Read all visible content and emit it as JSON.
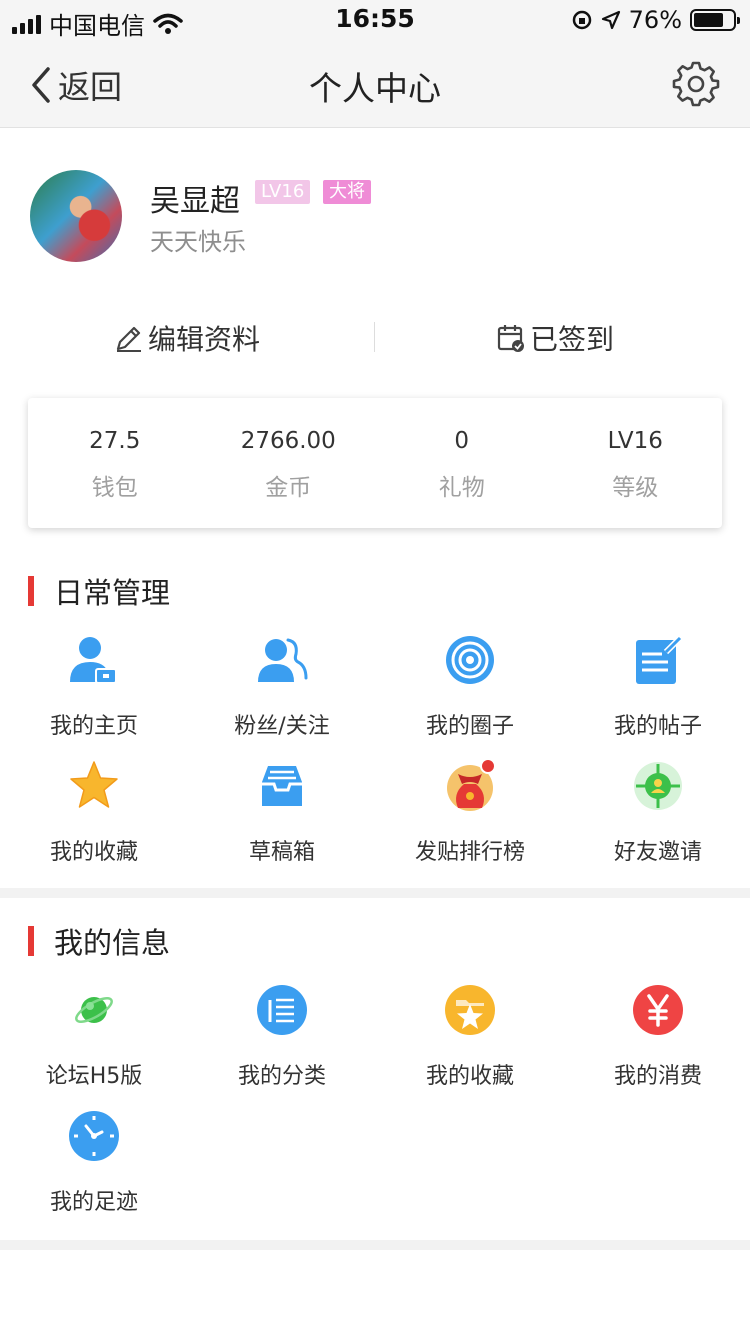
{
  "status": {
    "carrier": "中国电信",
    "time": "16:55",
    "battery": "76%",
    "battery_level": 0.76
  },
  "nav": {
    "back_label": "返回",
    "title": "个人中心"
  },
  "profile": {
    "name": "吴显超",
    "level_badge": "LV16",
    "rank_badge": "大将",
    "motto": "天天快乐",
    "edit_label": "编辑资料",
    "checkin_label": "已签到"
  },
  "stats": [
    {
      "value": "27.5",
      "label": "钱包"
    },
    {
      "value": "2766.00",
      "label": "金币"
    },
    {
      "value": "0",
      "label": "礼物"
    },
    {
      "value": "LV16",
      "label": "等级"
    }
  ],
  "daily": {
    "title": "日常管理",
    "items": [
      {
        "label": "我的主页",
        "icon": "user-home-icon"
      },
      {
        "label": "粉丝/关注",
        "icon": "followers-icon"
      },
      {
        "label": "我的圈子",
        "icon": "circle-icon"
      },
      {
        "label": "我的帖子",
        "icon": "post-edit-icon"
      },
      {
        "label": "我的收藏",
        "icon": "star-icon"
      },
      {
        "label": "草稿箱",
        "icon": "inbox-tray-icon"
      },
      {
        "label": "发贴排行榜",
        "icon": "money-bag-icon"
      },
      {
        "label": "好友邀请",
        "icon": "invite-target-icon"
      }
    ]
  },
  "info": {
    "title": "我的信息",
    "items": [
      {
        "label": "论坛H5版",
        "icon": "planet-icon"
      },
      {
        "label": "我的分类",
        "icon": "list-icon"
      },
      {
        "label": "我的收藏",
        "icon": "folder-star-icon"
      },
      {
        "label": "我的消费",
        "icon": "yen-icon"
      },
      {
        "label": "我的足迹",
        "icon": "clock-icon"
      }
    ]
  },
  "colors": {
    "accent": "#e53935",
    "blue": "#3b9ef0",
    "orange": "#f8b62d",
    "pink_badge": "#ef8cd6"
  }
}
